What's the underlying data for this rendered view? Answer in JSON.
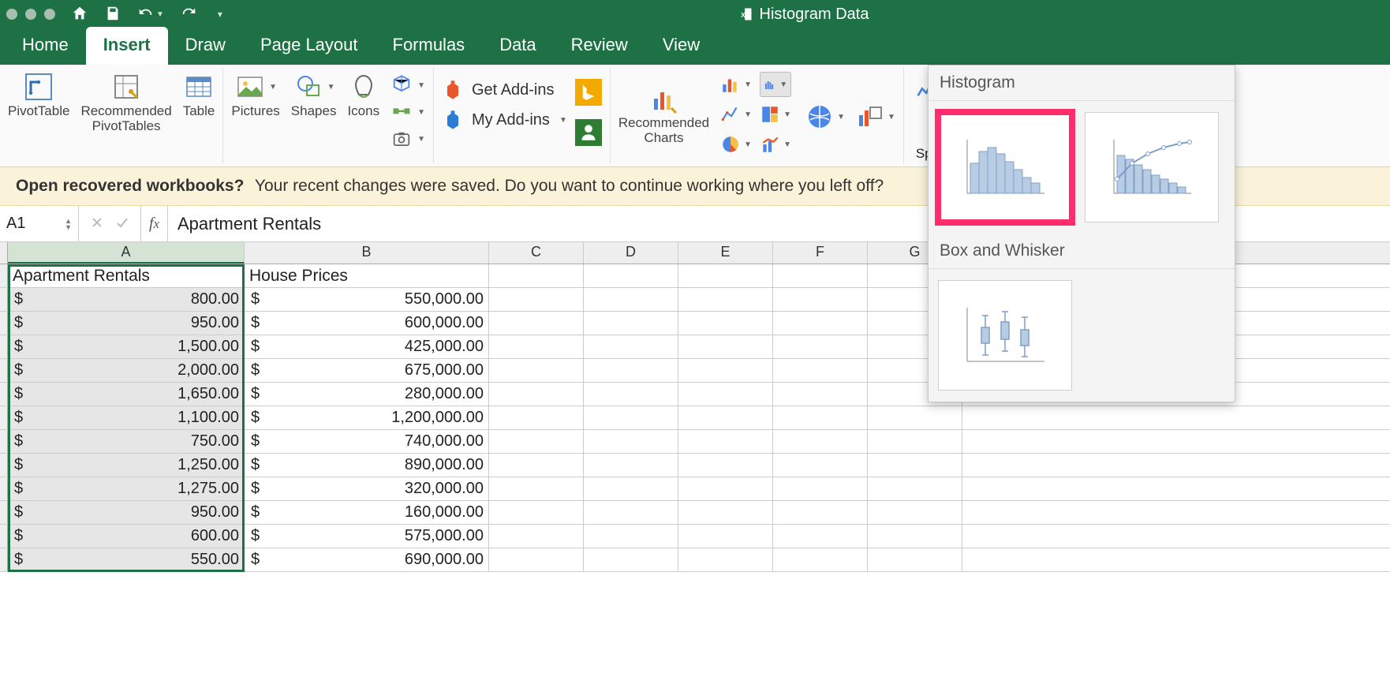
{
  "titlebar": {
    "document_name": "Histogram Data"
  },
  "tabs": {
    "home": "Home",
    "insert": "Insert",
    "draw": "Draw",
    "page_layout": "Page Layout",
    "formulas": "Formulas",
    "data": "Data",
    "review": "Review",
    "view": "View"
  },
  "ribbon": {
    "pivot_table": "PivotTable",
    "recommended_pivot": "Recommended\nPivotTables",
    "table": "Table",
    "pictures": "Pictures",
    "shapes": "Shapes",
    "icons": "Icons",
    "get_addins": "Get Add-ins",
    "my_addins": "My Add-ins",
    "recommended_charts": "Recommended\nCharts",
    "sparklines_partial": "Spa"
  },
  "msgbar": {
    "bold": "Open recovered workbooks?",
    "rest": "Your recent changes were saved. Do you want to continue working where you left off?"
  },
  "fbar": {
    "name": "A1",
    "formula": "Apartment Rentals"
  },
  "columns": [
    "A",
    "B",
    "C",
    "D",
    "E",
    "F",
    "G"
  ],
  "headers": {
    "A": "Apartment Rentals",
    "B": "House Prices"
  },
  "rows": [
    {
      "a": "800.00",
      "b": "550,000.00"
    },
    {
      "a": "950.00",
      "b": "600,000.00"
    },
    {
      "a": "1,500.00",
      "b": "425,000.00"
    },
    {
      "a": "2,000.00",
      "b": "675,000.00"
    },
    {
      "a": "1,650.00",
      "b": "280,000.00"
    },
    {
      "a": "1,100.00",
      "b": "1,200,000.00"
    },
    {
      "a": "750.00",
      "b": "740,000.00"
    },
    {
      "a": "1,250.00",
      "b": "890,000.00"
    },
    {
      "a": "1,275.00",
      "b": "320,000.00"
    },
    {
      "a": "950.00",
      "b": "160,000.00"
    },
    {
      "a": "600.00",
      "b": "575,000.00"
    },
    {
      "a": "550.00",
      "b": "690,000.00"
    }
  ],
  "popup": {
    "histogram": "Histogram",
    "box_whisker": "Box and Whisker"
  }
}
